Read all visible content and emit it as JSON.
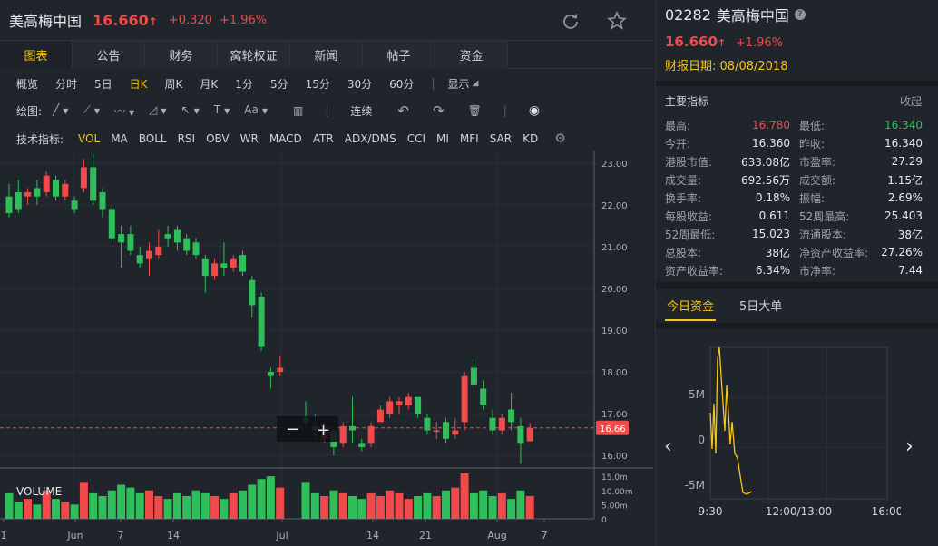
{
  "header": {
    "title": "美高梅中国",
    "price": "16.660",
    "up_arrow": "↑",
    "change": "+0.320",
    "change_pct": "+1.96%"
  },
  "main_tabs": [
    {
      "label": "图表",
      "active": true
    },
    {
      "label": "公告",
      "active": false
    },
    {
      "label": "财务",
      "active": false
    },
    {
      "label": "窝轮权证",
      "active": false
    },
    {
      "label": "新闻",
      "active": false
    },
    {
      "label": "帖子",
      "active": false
    },
    {
      "label": "资金",
      "active": false
    }
  ],
  "periods": [
    {
      "label": "概览",
      "active": false
    },
    {
      "label": "分时",
      "active": false
    },
    {
      "label": "5日",
      "active": false
    },
    {
      "label": "日K",
      "active": true
    },
    {
      "label": "周K",
      "active": false
    },
    {
      "label": "月K",
      "active": false
    },
    {
      "label": "1分",
      "active": false
    },
    {
      "label": "5分",
      "active": false
    },
    {
      "label": "15分",
      "active": false
    },
    {
      "label": "30分",
      "active": false
    },
    {
      "label": "60分",
      "active": false
    }
  ],
  "display_label": "显示",
  "draw_label": "绘图:",
  "draw_tools": [
    {
      "name": "line-tool-icon",
      "glyph": "╱"
    },
    {
      "name": "multi-line-tool-icon",
      "glyph": "⟋"
    },
    {
      "name": "wave-tool-icon",
      "glyph": "〰"
    },
    {
      "name": "measure-tool-icon",
      "glyph": "◿"
    },
    {
      "name": "arrow-tool-icon",
      "glyph": "↖"
    },
    {
      "name": "text-tool-icon",
      "glyph": "T"
    },
    {
      "name": "font-size-tool-icon",
      "glyph": "Aa"
    }
  ],
  "continuous_label": "连续",
  "indicator_label": "技术指标:",
  "indicators": [
    {
      "label": "VOL",
      "active": true
    },
    {
      "label": "MA",
      "active": false
    },
    {
      "label": "BOLL",
      "active": false
    },
    {
      "label": "RSI",
      "active": false
    },
    {
      "label": "OBV",
      "active": false
    },
    {
      "label": "WR",
      "active": false
    },
    {
      "label": "MACD",
      "active": false
    },
    {
      "label": "ATR",
      "active": false
    },
    {
      "label": "ADX/DMS",
      "active": false
    },
    {
      "label": "CCI",
      "active": false
    },
    {
      "label": "MI",
      "active": false
    },
    {
      "label": "MFI",
      "active": false
    },
    {
      "label": "SAR",
      "active": false
    },
    {
      "label": "KD",
      "active": false
    }
  ],
  "colors": {
    "up": "#f04a4a",
    "down": "#2fbf5a",
    "accent": "#f5c518",
    "bg": "#20242b"
  },
  "chart_data": {
    "type": "candlestick",
    "y_ticks": [
      "23.00",
      "22.00",
      "21.00",
      "20.00",
      "19.00",
      "18.00",
      "17.00",
      "16.00"
    ],
    "ylim": [
      15.7,
      23.3
    ],
    "current_price_label": "16.66",
    "current_price": 16.66,
    "x_tick_labels": [
      "1",
      "Jun",
      "7",
      "14",
      "Jul",
      "14",
      "21",
      "Aug",
      "7"
    ],
    "volume_label": "VOLUME",
    "volume_ticks": [
      "15.0m",
      "10.00m",
      "5.00m",
      "0"
    ],
    "volume_max": 16,
    "candles": [
      {
        "o": 22.2,
        "c": 21.8,
        "h": 22.5,
        "l": 21.7
      },
      {
        "o": 22.3,
        "c": 21.9,
        "h": 22.6,
        "l": 21.8
      },
      {
        "o": 22.2,
        "c": 22.3,
        "h": 22.4,
        "l": 22.0
      },
      {
        "o": 22.4,
        "c": 22.2,
        "h": 22.6,
        "l": 22.0
      },
      {
        "o": 22.3,
        "c": 22.7,
        "h": 22.8,
        "l": 22.2
      },
      {
        "o": 22.6,
        "c": 22.2,
        "h": 22.7,
        "l": 22.1
      },
      {
        "o": 22.2,
        "c": 22.5,
        "h": 22.6,
        "l": 22.1
      },
      {
        "o": 22.1,
        "c": 21.9,
        "h": 22.2,
        "l": 21.8
      },
      {
        "o": 22.4,
        "c": 22.9,
        "h": 23.1,
        "l": 22.3
      },
      {
        "o": 22.9,
        "c": 22.1,
        "h": 23.2,
        "l": 22.0
      },
      {
        "o": 22.3,
        "c": 21.9,
        "h": 22.4,
        "l": 21.7
      },
      {
        "o": 21.9,
        "c": 21.2,
        "h": 22.0,
        "l": 21.1
      },
      {
        "o": 21.3,
        "c": 21.1,
        "h": 21.5,
        "l": 20.5
      },
      {
        "o": 21.3,
        "c": 20.9,
        "h": 21.5,
        "l": 20.8
      },
      {
        "o": 20.8,
        "c": 20.6,
        "h": 21.0,
        "l": 20.5
      },
      {
        "o": 20.7,
        "c": 20.9,
        "h": 21.1,
        "l": 20.3
      },
      {
        "o": 20.8,
        "c": 21.0,
        "h": 21.4,
        "l": 20.7
      },
      {
        "o": 21.3,
        "c": 21.2,
        "h": 21.5,
        "l": 21.0
      },
      {
        "o": 21.4,
        "c": 21.1,
        "h": 21.5,
        "l": 20.9
      },
      {
        "o": 21.2,
        "c": 20.9,
        "h": 21.3,
        "l": 20.8
      },
      {
        "o": 21.1,
        "c": 20.8,
        "h": 21.2,
        "l": 20.7
      },
      {
        "o": 20.7,
        "c": 20.3,
        "h": 20.8,
        "l": 19.9
      },
      {
        "o": 20.3,
        "c": 20.6,
        "h": 20.7,
        "l": 20.2
      },
      {
        "o": 20.6,
        "c": 20.5,
        "h": 21.1,
        "l": 20.3
      },
      {
        "o": 20.5,
        "c": 20.7,
        "h": 20.8,
        "l": 20.4
      },
      {
        "o": 20.8,
        "c": 20.4,
        "h": 20.9,
        "l": 20.3
      },
      {
        "o": 20.2,
        "c": 19.6,
        "h": 20.3,
        "l": 19.3
      },
      {
        "o": 19.8,
        "c": 18.6,
        "h": 19.9,
        "l": 18.5
      },
      {
        "o": 18.0,
        "c": 17.9,
        "h": 18.1,
        "l": 17.6
      },
      {
        "o": 18.0,
        "c": 18.1,
        "h": 18.4,
        "l": 17.9
      },
      {
        "o": 16.9,
        "c": 16.8,
        "h": 17.3,
        "l": 16.7
      },
      {
        "o": 16.7,
        "c": 16.6,
        "h": 17.0,
        "l": 16.4
      },
      {
        "o": 16.4,
        "c": 16.6,
        "h": 16.8,
        "l": 16.3
      },
      {
        "o": 16.6,
        "c": 16.2,
        "h": 16.7,
        "l": 16.0
      },
      {
        "o": 16.3,
        "c": 16.7,
        "h": 16.8,
        "l": 16.2
      },
      {
        "o": 16.7,
        "c": 16.6,
        "h": 17.4,
        "l": 16.3
      },
      {
        "o": 16.3,
        "c": 16.2,
        "h": 16.4,
        "l": 16.1
      },
      {
        "o": 16.3,
        "c": 16.7,
        "h": 16.8,
        "l": 16.2
      },
      {
        "o": 16.8,
        "c": 17.1,
        "h": 17.2,
        "l": 16.8
      },
      {
        "o": 17.0,
        "c": 17.3,
        "h": 17.4,
        "l": 16.9
      },
      {
        "o": 17.2,
        "c": 17.3,
        "h": 17.4,
        "l": 17.0
      },
      {
        "o": 17.2,
        "c": 17.4,
        "h": 17.5,
        "l": 17.1
      },
      {
        "o": 17.4,
        "c": 17.0,
        "h": 17.4,
        "l": 16.9
      },
      {
        "o": 16.9,
        "c": 16.6,
        "h": 17.0,
        "l": 16.5
      },
      {
        "o": 16.6,
        "c": 16.6,
        "h": 16.8,
        "l": 16.4
      },
      {
        "o": 16.8,
        "c": 16.4,
        "h": 16.9,
        "l": 16.3
      },
      {
        "o": 16.5,
        "c": 16.6,
        "h": 16.9,
        "l": 16.4
      },
      {
        "o": 16.8,
        "c": 17.9,
        "h": 18.0,
        "l": 16.6
      },
      {
        "o": 18.1,
        "c": 17.7,
        "h": 18.3,
        "l": 17.6
      },
      {
        "o": 17.6,
        "c": 17.2,
        "h": 17.8,
        "l": 17.1
      },
      {
        "o": 16.9,
        "c": 16.6,
        "h": 17.1,
        "l": 16.5
      },
      {
        "o": 16.6,
        "c": 16.9,
        "h": 17.0,
        "l": 16.5
      },
      {
        "o": 17.1,
        "c": 16.8,
        "h": 17.5,
        "l": 16.6
      },
      {
        "o": 16.7,
        "c": 16.3,
        "h": 16.9,
        "l": 15.8
      },
      {
        "o": 16.34,
        "c": 16.66,
        "h": 16.78,
        "l": 16.34
      }
    ],
    "volumes": [
      9,
      6,
      7,
      5,
      10,
      7,
      6,
      5,
      13,
      9,
      8,
      10,
      12,
      11,
      9,
      10,
      8,
      7,
      9,
      8,
      10,
      9,
      8,
      7,
      9,
      10,
      12,
      14,
      15,
      11,
      13,
      9,
      8,
      10,
      9,
      8,
      7,
      9,
      8,
      10,
      9,
      7,
      8,
      9,
      8,
      10,
      11,
      16,
      9,
      10,
      8,
      9,
      7,
      10,
      8
    ]
  },
  "right": {
    "code": "02282",
    "name": "美高梅中国",
    "help_icon": "?",
    "price": "16.660",
    "up_arrow": "↑",
    "change_pct": "+1.96%",
    "report_label": "财报日期:",
    "report_date": "08/08/2018",
    "indicators_title": "主要指标",
    "collapse_label": "收起",
    "metrics": [
      {
        "l1": "最高:",
        "v1": "16.780",
        "c1": "#f04a4a",
        "l2": "最低:",
        "v2": "16.340",
        "c2": "#2fbf5a"
      },
      {
        "l1": "今开:",
        "v1": "16.360",
        "c1": "",
        "l2": "昨收:",
        "v2": "16.340",
        "c2": ""
      },
      {
        "l1": "港股市值:",
        "v1": "633.08亿",
        "c1": "",
        "l2": "市盈率:",
        "v2": "27.29",
        "c2": ""
      },
      {
        "l1": "成交量:",
        "v1": "692.56万",
        "c1": "",
        "l2": "成交额:",
        "v2": "1.15亿",
        "c2": ""
      },
      {
        "l1": "换手率:",
        "v1": "0.18%",
        "c1": "",
        "l2": "振幅:",
        "v2": "2.69%",
        "c2": ""
      },
      {
        "l1": "每股收益:",
        "v1": "0.611",
        "c1": "",
        "l2": "52周最高:",
        "v2": "25.403",
        "c2": ""
      },
      {
        "l1": "52周最低:",
        "v1": "15.023",
        "c1": "",
        "l2": "流通股本:",
        "v2": "38亿",
        "c2": ""
      },
      {
        "l1": "总股本:",
        "v1": "38亿",
        "c1": "",
        "l2": "净资产收益率:",
        "v2": "27.26%",
        "c2": ""
      },
      {
        "l1": "资产收益率:",
        "v1": "6.34%",
        "c1": "",
        "l2": "市净率:",
        "v2": "7.44",
        "c2": ""
      }
    ],
    "fund_tabs": [
      {
        "label": "今日资金",
        "active": true
      },
      {
        "label": "5日大单",
        "active": false
      }
    ],
    "fund_chart": {
      "y_ticks": [
        "5M",
        "0",
        "-5M"
      ],
      "x_ticks": [
        "9:30",
        "12:00/13:00",
        "16:00"
      ]
    }
  }
}
